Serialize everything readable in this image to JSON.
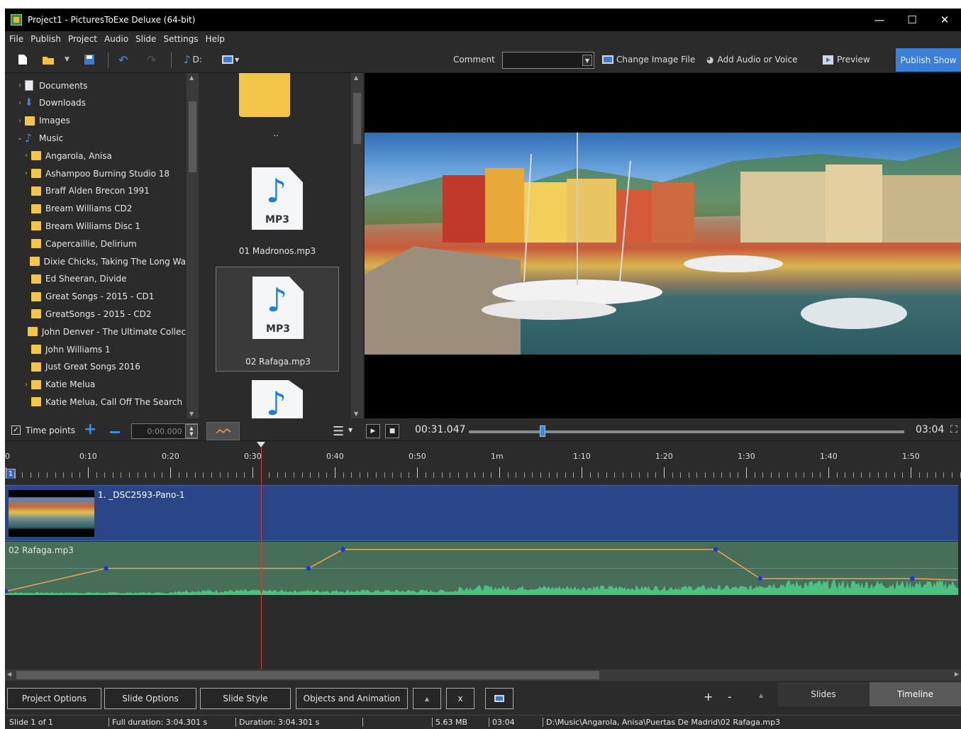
{
  "window": {
    "title": "Project1 - PicturesToExe Deluxe (64-bit)",
    "minimize": "—",
    "maximize": "☐",
    "close": "✕"
  },
  "menu": [
    "File",
    "Publish",
    "Project",
    "Audio",
    "Slide",
    "Settings",
    "Help"
  ],
  "toolbar": {
    "drive_label": "D:",
    "comment_label": "Comment",
    "comment_value": "",
    "change_image": "Change Image File",
    "add_audio": "Add Audio or Voice",
    "preview": "Preview",
    "publish": "Publish Show"
  },
  "tree": [
    {
      "label": "Documents",
      "icon": "documents-icon",
      "expandable": true,
      "indent": 0
    },
    {
      "label": "Downloads",
      "icon": "downloads-icon",
      "expandable": true,
      "indent": 0
    },
    {
      "label": "Images",
      "icon": "folder-icon",
      "expandable": true,
      "indent": 0
    },
    {
      "label": "Music",
      "icon": "music-icon",
      "expandable": true,
      "expanded": true,
      "indent": 0
    },
    {
      "label": "Angarola, Anisa",
      "icon": "folder-icon",
      "expandable": true,
      "indent": 1
    },
    {
      "label": "Ashampoo Burning Studio 18",
      "icon": "folder-icon",
      "expandable": true,
      "indent": 1
    },
    {
      "label": "Braff Alden Brecon 1991",
      "icon": "folder-icon",
      "expandable": false,
      "indent": 1
    },
    {
      "label": "Bream Williams CD2",
      "icon": "folder-icon",
      "expandable": false,
      "indent": 1
    },
    {
      "label": "Bream Williams Disc 1",
      "icon": "folder-icon",
      "expandable": false,
      "indent": 1
    },
    {
      "label": "Capercaillie, Delirium",
      "icon": "folder-icon",
      "expandable": false,
      "indent": 1
    },
    {
      "label": "Dixie Chicks, Taking The Long Wa",
      "icon": "folder-icon",
      "expandable": false,
      "indent": 1
    },
    {
      "label": "Ed Sheeran, Divide",
      "icon": "folder-icon",
      "expandable": false,
      "indent": 1
    },
    {
      "label": "Great Songs - 2015 - CD1",
      "icon": "folder-icon",
      "expandable": false,
      "indent": 1
    },
    {
      "label": "GreatSongs - 2015 - CD2",
      "icon": "folder-icon",
      "expandable": false,
      "indent": 1
    },
    {
      "label": "John Denver - The Ultimate Collec",
      "icon": "folder-icon",
      "expandable": false,
      "indent": 1
    },
    {
      "label": "John Williams 1",
      "icon": "folder-icon",
      "expandable": false,
      "indent": 1
    },
    {
      "label": "Just Great Songs 2016",
      "icon": "folder-icon",
      "expandable": false,
      "indent": 1
    },
    {
      "label": "Katie Melua",
      "icon": "folder-icon",
      "expandable": true,
      "indent": 1
    },
    {
      "label": "Katie Melua, Call Off The Search",
      "icon": "folder-icon",
      "expandable": false,
      "indent": 1
    }
  ],
  "files": {
    "parent_label": "..",
    "items": [
      {
        "name": "01 Madronos.mp3",
        "badge": "MP3",
        "selected": false
      },
      {
        "name": "02 Rafaga.mp3",
        "badge": "MP3",
        "selected": true
      }
    ]
  },
  "timepoints": {
    "label": "Time points",
    "checked": true,
    "time_value": "0:00.000",
    "current_time": "00:31.047",
    "total_time": "03:04",
    "position_fraction": 0.169
  },
  "ruler": {
    "labels": [
      "0",
      "0:10",
      "0:20",
      "0:30",
      "0:40",
      "0:50",
      "1m",
      "1:10",
      "1:20",
      "1:30",
      "1:40",
      "1:50"
    ],
    "slide_marker": "1"
  },
  "tracks": {
    "image_label": "1. _DSC2593-Pano-1",
    "audio_label": "02 Rafaga.mp3",
    "volume_points_sec": [
      0,
      12.2,
      36.8,
      41.0,
      86.3,
      91.7,
      110.2,
      116.0
    ],
    "volume_levels": [
      0.03,
      0.48,
      0.48,
      0.85,
      0.85,
      0.28,
      0.28,
      0.25
    ],
    "playhead_sec": 31.047,
    "colors": {
      "image_track": "#2a4687",
      "audio_track": "#476e59",
      "waveform": "#4fd08a",
      "volume_line": "#f0a25a",
      "volume_point": "#2330e0"
    }
  },
  "bottom": {
    "buttons": [
      "Project Options",
      "Slide Options",
      "Slide Style",
      "Objects and Animation"
    ],
    "up_symbol": "▲",
    "x_symbol": "x",
    "plus": "+",
    "minus": "-",
    "tab_slides": "Slides",
    "tab_timeline": "Timeline"
  },
  "status": {
    "slide": "Slide 1 of 1",
    "full_duration": "Full duration: 3:04.301 s",
    "duration": "Duration: 3:04.301 s",
    "size": "5.63 MB",
    "length": "03:04",
    "path": "D:\\Music\\Angarola, Anisa\\Puertas De Madrid\\02 Rafaga.mp3"
  }
}
